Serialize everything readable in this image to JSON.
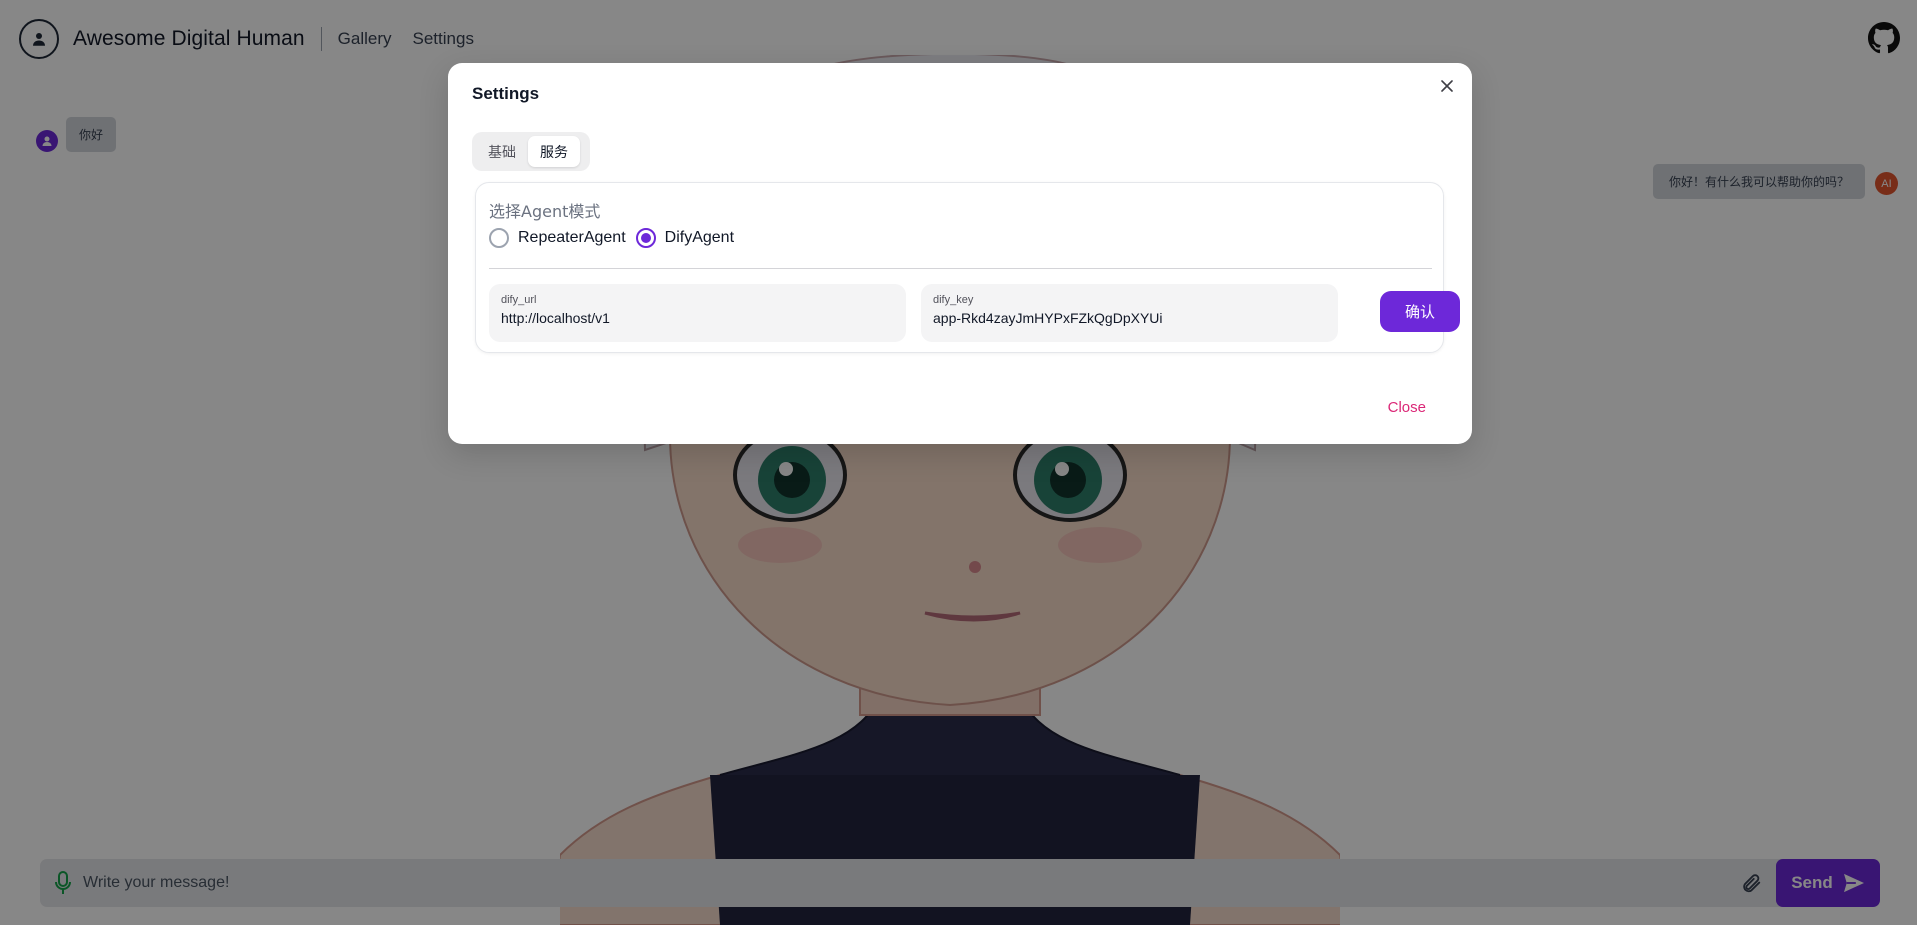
{
  "app": {
    "title": "Awesome Digital Human"
  },
  "nav": {
    "items": [
      {
        "label": "Gallery"
      },
      {
        "label": "Settings"
      }
    ]
  },
  "chat": {
    "messages": [
      {
        "role": "user",
        "text": "你好"
      },
      {
        "role": "ai",
        "text": "你好！有什么我可以帮助你的吗？",
        "avatar": "AI"
      }
    ]
  },
  "composer": {
    "placeholder": "Write your message!",
    "send_label": "Send"
  },
  "settings_modal": {
    "title": "Settings",
    "tabs": [
      {
        "label": "基础",
        "active": false
      },
      {
        "label": "服务",
        "active": true
      }
    ],
    "agent_mode_label": "选择Agent模式",
    "agent_options": [
      {
        "label": "RepeaterAgent",
        "selected": false
      },
      {
        "label": "DifyAgent",
        "selected": true
      }
    ],
    "fields": [
      {
        "label": "dify_url",
        "value": "http://localhost/v1"
      },
      {
        "label": "dify_key",
        "value": "app-Rkd4zayJmHYPxFZkQgDpXYUi"
      }
    ],
    "confirm_label": "确认",
    "close_label": "Close"
  },
  "colors": {
    "accent": "#6d28d9",
    "close_link": "#db2777",
    "ai_avatar": "#e2562f",
    "overlay": "rgba(0,0,0,0.47)"
  },
  "icons": {
    "logo": "user-circle-icon",
    "github": "github-icon",
    "mic": "microphone-icon",
    "attach": "paperclip-icon",
    "send": "send-arrow-icon",
    "close": "x-icon"
  }
}
